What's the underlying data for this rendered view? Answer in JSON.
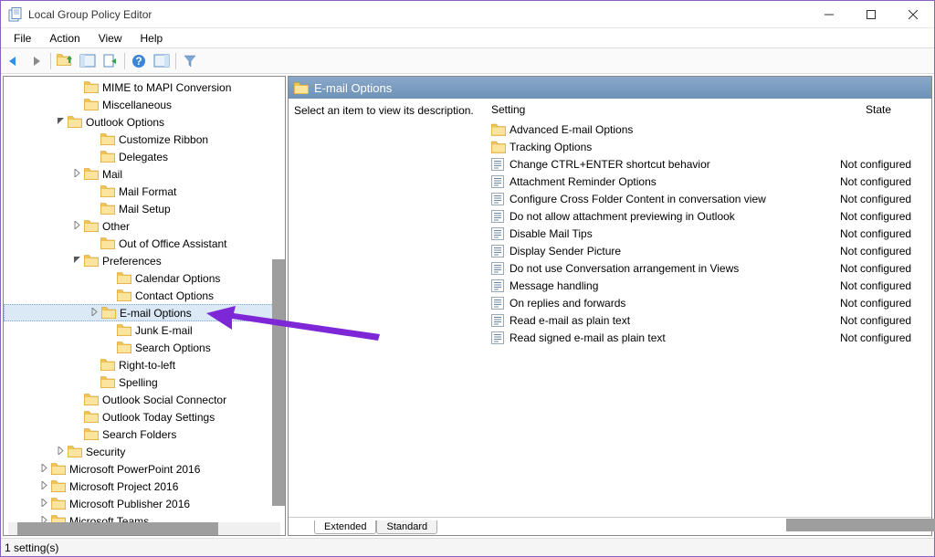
{
  "window": {
    "title": "Local Group Policy Editor"
  },
  "menubar": [
    "File",
    "Action",
    "View",
    "Help"
  ],
  "toolbar_icons": [
    "back",
    "forward",
    "up",
    "show-hide-tree",
    "export-list",
    "help",
    "show-hide-action",
    "filter"
  ],
  "tree": [
    {
      "depth": 4,
      "exp": "",
      "label": "MIME to MAPI Conversion",
      "sel": false
    },
    {
      "depth": 4,
      "exp": "",
      "label": "Miscellaneous",
      "sel": false
    },
    {
      "depth": 3,
      "exp": "v",
      "label": "Outlook Options",
      "sel": false
    },
    {
      "depth": 5,
      "exp": "",
      "label": "Customize Ribbon",
      "sel": false
    },
    {
      "depth": 5,
      "exp": "",
      "label": "Delegates",
      "sel": false
    },
    {
      "depth": 4,
      "exp": ">",
      "label": "Mail",
      "sel": false
    },
    {
      "depth": 5,
      "exp": "",
      "label": "Mail Format",
      "sel": false
    },
    {
      "depth": 5,
      "exp": "",
      "label": "Mail Setup",
      "sel": false
    },
    {
      "depth": 4,
      "exp": ">",
      "label": "Other",
      "sel": false
    },
    {
      "depth": 5,
      "exp": "",
      "label": "Out of Office Assistant",
      "sel": false
    },
    {
      "depth": 4,
      "exp": "v",
      "label": "Preferences",
      "sel": false
    },
    {
      "depth": 6,
      "exp": "",
      "label": "Calendar Options",
      "sel": false
    },
    {
      "depth": 6,
      "exp": "",
      "label": "Contact Options",
      "sel": false
    },
    {
      "depth": 5,
      "exp": ">",
      "label": "E-mail Options",
      "sel": true
    },
    {
      "depth": 6,
      "exp": "",
      "label": "Junk E-mail",
      "sel": false
    },
    {
      "depth": 6,
      "exp": "",
      "label": "Search Options",
      "sel": false
    },
    {
      "depth": 5,
      "exp": "",
      "label": "Right-to-left",
      "sel": false
    },
    {
      "depth": 5,
      "exp": "",
      "label": "Spelling",
      "sel": false
    },
    {
      "depth": 4,
      "exp": "",
      "label": "Outlook Social Connector",
      "sel": false
    },
    {
      "depth": 4,
      "exp": "",
      "label": "Outlook Today Settings",
      "sel": false
    },
    {
      "depth": 4,
      "exp": "",
      "label": "Search Folders",
      "sel": false
    },
    {
      "depth": 3,
      "exp": ">",
      "label": "Security",
      "sel": false
    },
    {
      "depth": 2,
      "exp": ">",
      "label": "Microsoft PowerPoint 2016",
      "sel": false
    },
    {
      "depth": 2,
      "exp": ">",
      "label": "Microsoft Project 2016",
      "sel": false
    },
    {
      "depth": 2,
      "exp": ">",
      "label": "Microsoft Publisher 2016",
      "sel": false
    },
    {
      "depth": 2,
      "exp": ">",
      "label": "Microsoft Teams",
      "sel": false
    }
  ],
  "content": {
    "header": "E-mail Options",
    "description": "Select an item to view its description.",
    "columns": {
      "setting": "Setting",
      "state": "State"
    },
    "settings": [
      {
        "type": "folder",
        "name": "Advanced E-mail Options",
        "state": ""
      },
      {
        "type": "folder",
        "name": "Tracking Options",
        "state": ""
      },
      {
        "type": "policy",
        "name": "Change CTRL+ENTER shortcut behavior",
        "state": "Not configured"
      },
      {
        "type": "policy",
        "name": "Attachment Reminder Options",
        "state": "Not configured"
      },
      {
        "type": "policy",
        "name": "Configure Cross Folder Content in conversation view",
        "state": "Not configured"
      },
      {
        "type": "policy",
        "name": "Do not allow attachment previewing in Outlook",
        "state": "Not configured"
      },
      {
        "type": "policy",
        "name": "Disable Mail Tips",
        "state": "Not configured"
      },
      {
        "type": "policy",
        "name": "Display Sender Picture",
        "state": "Not configured"
      },
      {
        "type": "policy",
        "name": "Do not use Conversation arrangement in Views",
        "state": "Not configured"
      },
      {
        "type": "policy",
        "name": "Message handling",
        "state": "Not configured"
      },
      {
        "type": "policy",
        "name": "On replies and forwards",
        "state": "Not configured"
      },
      {
        "type": "policy",
        "name": "Read e-mail as plain text",
        "state": "Not configured"
      },
      {
        "type": "policy",
        "name": "Read signed e-mail as plain text",
        "state": "Not configured"
      }
    ]
  },
  "tabs": [
    {
      "label": "Extended",
      "active": true
    },
    {
      "label": "Standard",
      "active": false
    }
  ],
  "statusbar": "1 setting(s)"
}
